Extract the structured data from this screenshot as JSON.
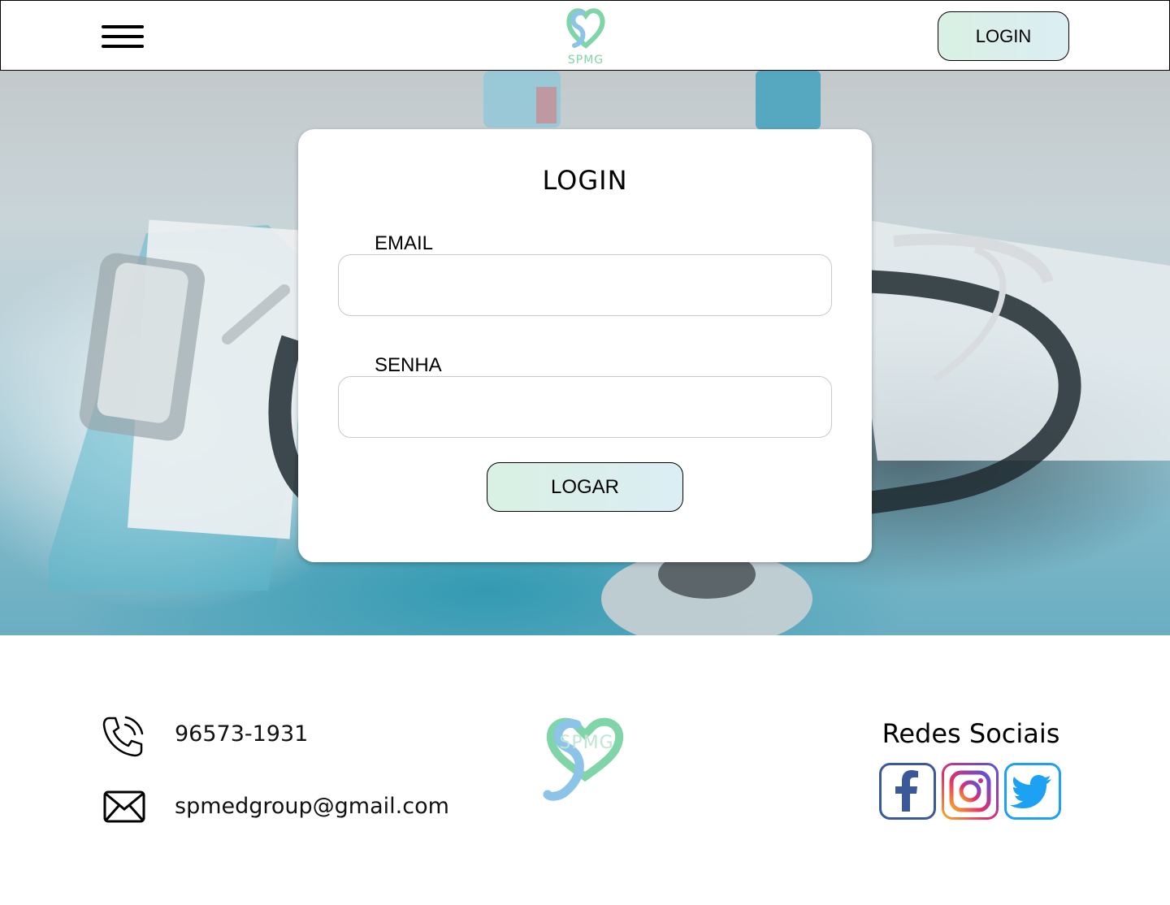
{
  "header": {
    "menu_icon": "hamburger-menu-icon",
    "logo_text": "SPMG",
    "login_label": "LOGIN"
  },
  "login_card": {
    "title": "LOGIN",
    "email_label": "EMAIL",
    "email_value": "",
    "password_label": "SENHA",
    "password_value": "",
    "submit_label": "LOGAR"
  },
  "footer": {
    "phone_icon": "phone-icon",
    "phone": "96573-1931",
    "email_icon": "mail-icon",
    "email": "spmedgroup@gmail.com",
    "logo_text": "SPMG",
    "social_title": "Redes Sociais",
    "social": [
      {
        "icon": "facebook-icon",
        "color": "#3b5998"
      },
      {
        "icon": "instagram-icon",
        "color": "#c13584"
      },
      {
        "icon": "twitter-icon",
        "color": "#1da1f2"
      }
    ]
  },
  "colors": {
    "brand_green": "#7fd4a8",
    "brand_blue": "#8cc4e8",
    "button_gradient_start": "#d9f0e3",
    "button_gradient_end": "#dbeef4"
  }
}
